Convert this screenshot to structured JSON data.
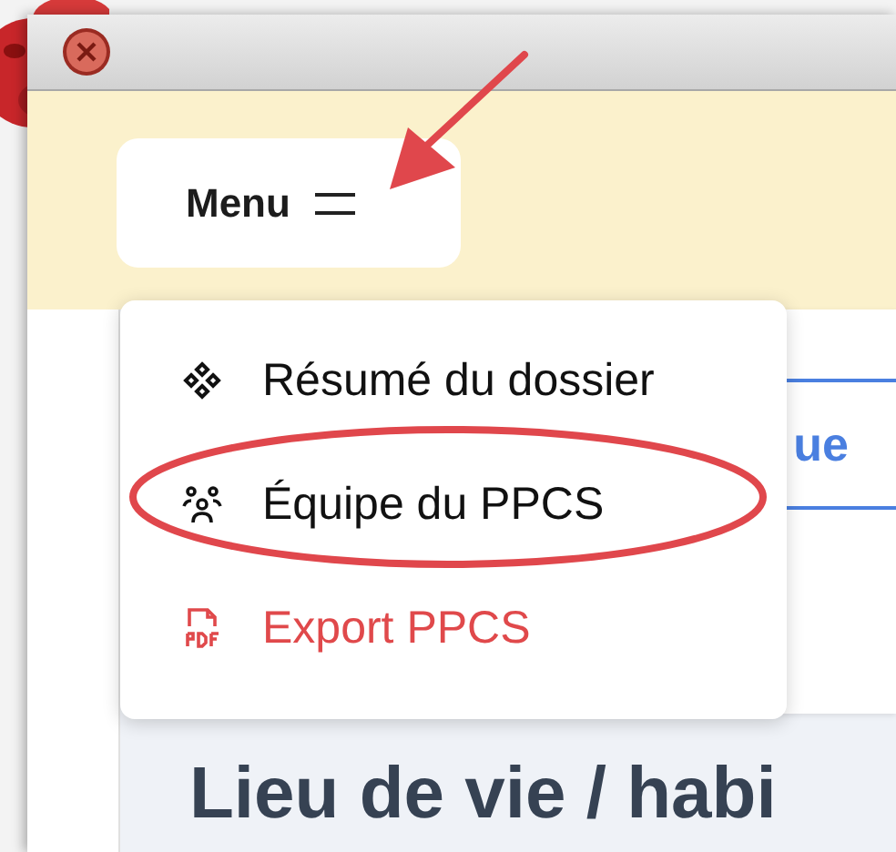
{
  "menu_button": {
    "label": "Menu",
    "pointed_at": true
  },
  "menu": {
    "items": [
      {
        "label": "Résumé du dossier",
        "kind": "summary",
        "circled": false
      },
      {
        "label": "Équipe du PPCS",
        "kind": "team",
        "circled": true
      },
      {
        "label": "Export PPCS",
        "kind": "pdf",
        "circled": false
      }
    ]
  },
  "tabs": [
    {
      "label": "ue"
    }
  ],
  "heading": "Lieu de vie / habi"
}
